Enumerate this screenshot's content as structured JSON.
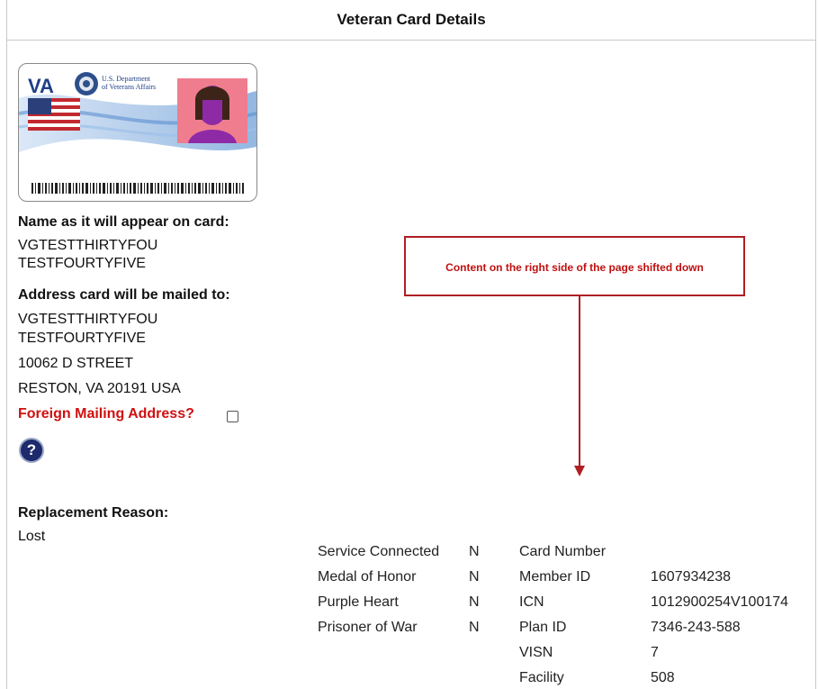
{
  "header": {
    "title": "Veteran Card Details"
  },
  "card": {
    "logo": "VA",
    "department_line1": "U.S. Department",
    "department_line2": "of Veterans Affairs"
  },
  "name_section": {
    "label": "Name as it will appear on card:",
    "line1": "VGTESTTHIRTYFOU",
    "line2": "TESTFOURTYFIVE"
  },
  "address_section": {
    "label": "Address card will be mailed to:",
    "line1": "VGTESTTHIRTYFOU",
    "line2": "TESTFOURTYFIVE",
    "street": "10062 D STREET",
    "city_state": "RESTON, VA 20191 USA",
    "foreign_label": "Foreign Mailing Address?"
  },
  "help_icon": "?",
  "replacement": {
    "label": "Replacement Reason:",
    "value": "Lost"
  },
  "annotation": {
    "text": "Content on the right side of the page shifted down"
  },
  "flags": [
    {
      "label": "Service Connected",
      "value": "N"
    },
    {
      "label": "Medal of Honor",
      "value": "N"
    },
    {
      "label": "Purple Heart",
      "value": "N"
    },
    {
      "label": "Prisoner of War",
      "value": "N"
    }
  ],
  "details": [
    {
      "label": "Card Number",
      "value": ""
    },
    {
      "label": "Member ID",
      "value": "1607934238"
    },
    {
      "label": "ICN",
      "value": "1012900254V100174"
    },
    {
      "label": "Plan ID",
      "value": "7346-243-588"
    },
    {
      "label": "VISN",
      "value": "7"
    },
    {
      "label": "Facility",
      "value": "508"
    }
  ],
  "colors": {
    "accent_red": "#d01010",
    "annotation_red": "#b01e24",
    "help_navy": "#1d2a6b"
  }
}
